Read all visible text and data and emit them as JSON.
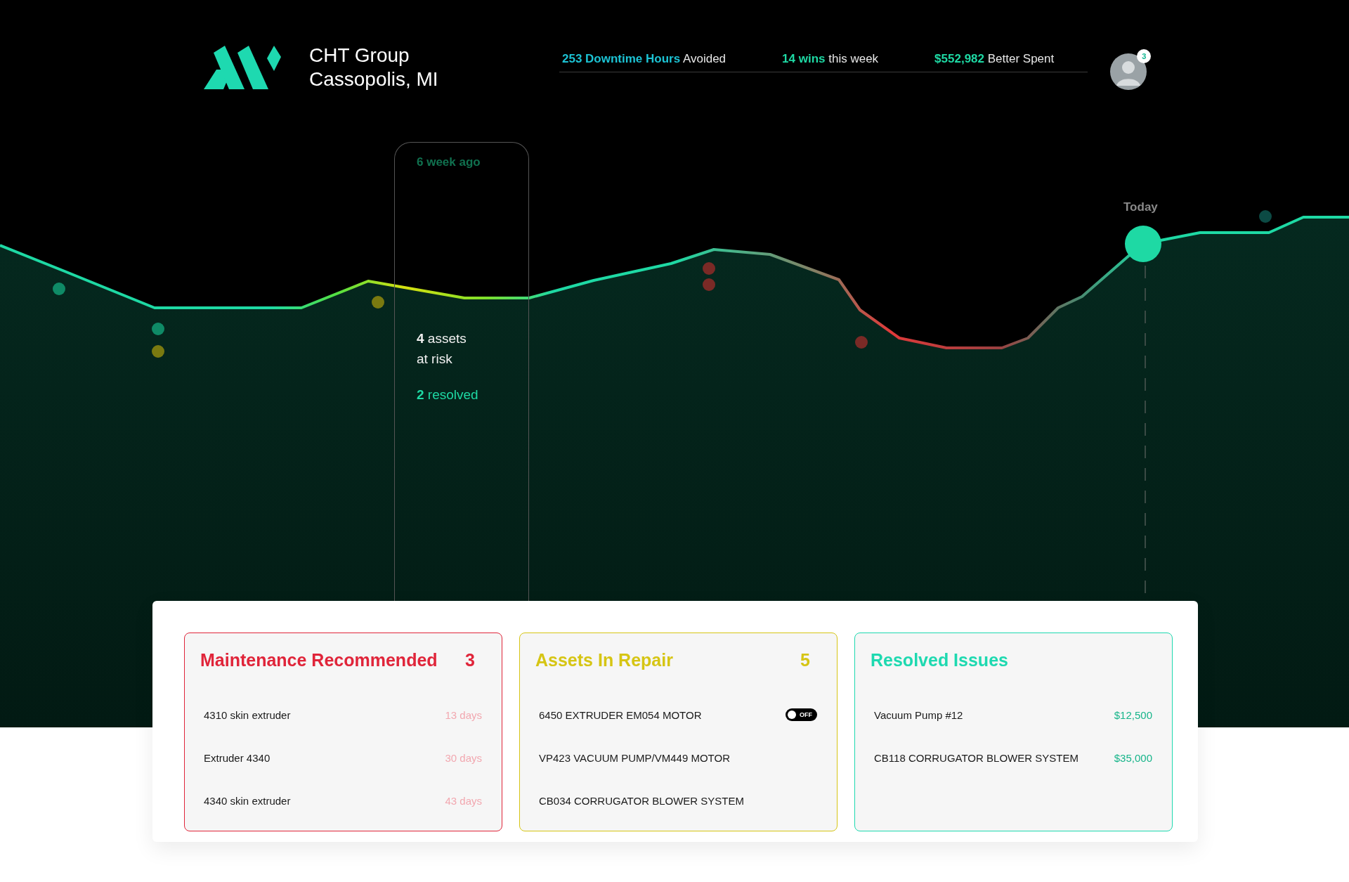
{
  "brand": {
    "name": "CHT Group",
    "location": "Cassopolis, MI"
  },
  "stats": [
    {
      "value": "253 Downtime Hours",
      "label": "Avoided",
      "color": "#1cc3d4"
    },
    {
      "value": "14 wins",
      "label": "this week",
      "color": "#1ed9a4"
    },
    {
      "value": "$552,982",
      "label": "Better Spent",
      "color": "#1ed9a4"
    }
  ],
  "user": {
    "notification_count": "3"
  },
  "chart": {
    "tooltip": {
      "period": "6 week ago",
      "assets_line": "**4** assets",
      "risk_line": "at risk",
      "resolved_line": "**2** resolved"
    },
    "today_label": "Today"
  },
  "cards": [
    {
      "title": "Maintenance Recommended",
      "count": "3",
      "color": "#e0253a",
      "items": [
        {
          "kind": "days",
          "name": "4310 skin extruder",
          "value": "13 days"
        },
        {
          "kind": "days",
          "name": "Extruder 4340",
          "value": "30 days"
        },
        {
          "kind": "days",
          "name": "4340 skin extruder",
          "value": "43 days"
        }
      ]
    },
    {
      "title": "Assets In Repair",
      "count": "5",
      "color": "#d6c514",
      "items": [
        {
          "kind": "toggle",
          "name": "6450 EXTRUDER EM054 MOTOR",
          "toggle": {
            "label": "OFF",
            "on": false
          }
        },
        {
          "kind": "plain",
          "name": "VP423 VACUUM PUMP/VM449 MOTOR"
        },
        {
          "kind": "plain",
          "name": "CB034 CORRUGATOR BLOWER SYSTEM"
        }
      ]
    },
    {
      "title": "Resolved Issues",
      "color": "#1ed9b0",
      "items": [
        {
          "kind": "amount",
          "name": "Vacuum Pump #12",
          "value": "$12,500"
        },
        {
          "kind": "amount",
          "name": "CB118  CORRUGATOR BLOWER SYSTEM",
          "value": "$35,000"
        }
      ]
    }
  ]
}
